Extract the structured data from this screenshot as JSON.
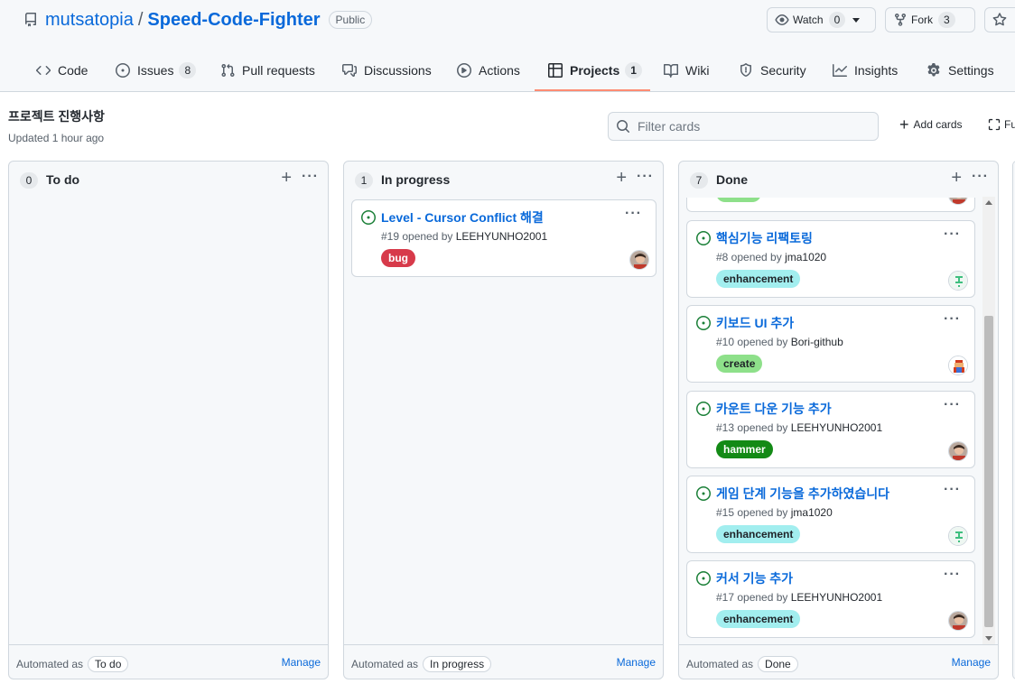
{
  "repo": {
    "owner": "mutsatopia",
    "separator": "/",
    "name": "Speed-Code-Fighter",
    "visibility": "Public"
  },
  "actions": {
    "watch": {
      "label": "Watch",
      "count": "0"
    },
    "fork": {
      "label": "Fork",
      "count": "3"
    }
  },
  "tabs": [
    {
      "label": "Code",
      "icon": "code-icon"
    },
    {
      "label": "Issues",
      "count": "8",
      "icon": "issue-opened-icon"
    },
    {
      "label": "Pull requests",
      "icon": "git-pull-request-icon"
    },
    {
      "label": "Discussions",
      "icon": "comment-discussion-icon"
    },
    {
      "label": "Actions",
      "icon": "play-icon"
    },
    {
      "label": "Projects",
      "count": "1",
      "icon": "table-icon",
      "selected": true
    },
    {
      "label": "Wiki",
      "icon": "book-icon"
    },
    {
      "label": "Security",
      "icon": "shield-icon"
    },
    {
      "label": "Insights",
      "icon": "graph-icon"
    },
    {
      "label": "Settings",
      "icon": "gear-icon"
    }
  ],
  "project": {
    "name": "프로젝트 진행사항",
    "updated": "Updated 1 hour ago",
    "filter_placeholder": "Filter cards",
    "add_cards": "Add cards",
    "fullscreen": "Fu"
  },
  "columns": [
    {
      "count": "0",
      "title": "To do",
      "automated_label": "Automated as",
      "automated_as": "To do",
      "manage": "Manage",
      "cards": []
    },
    {
      "count": "1",
      "title": "In progress",
      "automated_label": "Automated as",
      "automated_as": "In progress",
      "manage": "Manage",
      "cards": [
        {
          "title": "Level - Cursor Conflict 해결",
          "meta_prefix": "#19 opened by",
          "author": "LEEHYUNHO2001",
          "label": "bug",
          "label_color": "#d73a4a",
          "label_text_color": "#ffffff"
        }
      ]
    },
    {
      "count": "7",
      "title": "Done",
      "automated_label": "Automated as",
      "automated_as": "Done",
      "manage": "Manage",
      "cards": [
        {
          "title": "핵심기능 리팩토링",
          "meta_prefix": "#8 opened by",
          "author": "jma1020",
          "label": "enhancement",
          "label_color": "#a2eeef",
          "label_text_color": "#1f2328"
        },
        {
          "title": "키보드 UI 추가",
          "meta_prefix": "#10 opened by",
          "author": "Bori-github",
          "label": "create",
          "label_color": "#8ee08a",
          "label_text_color": "#1f2328"
        },
        {
          "title": "카운트 다운 기능 추가",
          "meta_prefix": "#13 opened by",
          "author": "LEEHYUNHO2001",
          "label": "hammer",
          "label_color": "#138a16",
          "label_text_color": "#ffffff"
        },
        {
          "title": "게임 단계 기능을 추가하였습니다",
          "meta_prefix": "#15 opened by",
          "author": "jma1020",
          "label": "enhancement",
          "label_color": "#a2eeef",
          "label_text_color": "#1f2328"
        },
        {
          "title": "커서 기능 추가",
          "meta_prefix": "#17 opened by",
          "author": "LEEHYUNHO2001",
          "label": "enhancement",
          "label_color": "#a2eeef",
          "label_text_color": "#1f2328"
        }
      ]
    }
  ],
  "colors": {
    "link": "#0969da",
    "open_issue": "#1a7f37",
    "tab_underline": "#fd8c73"
  }
}
